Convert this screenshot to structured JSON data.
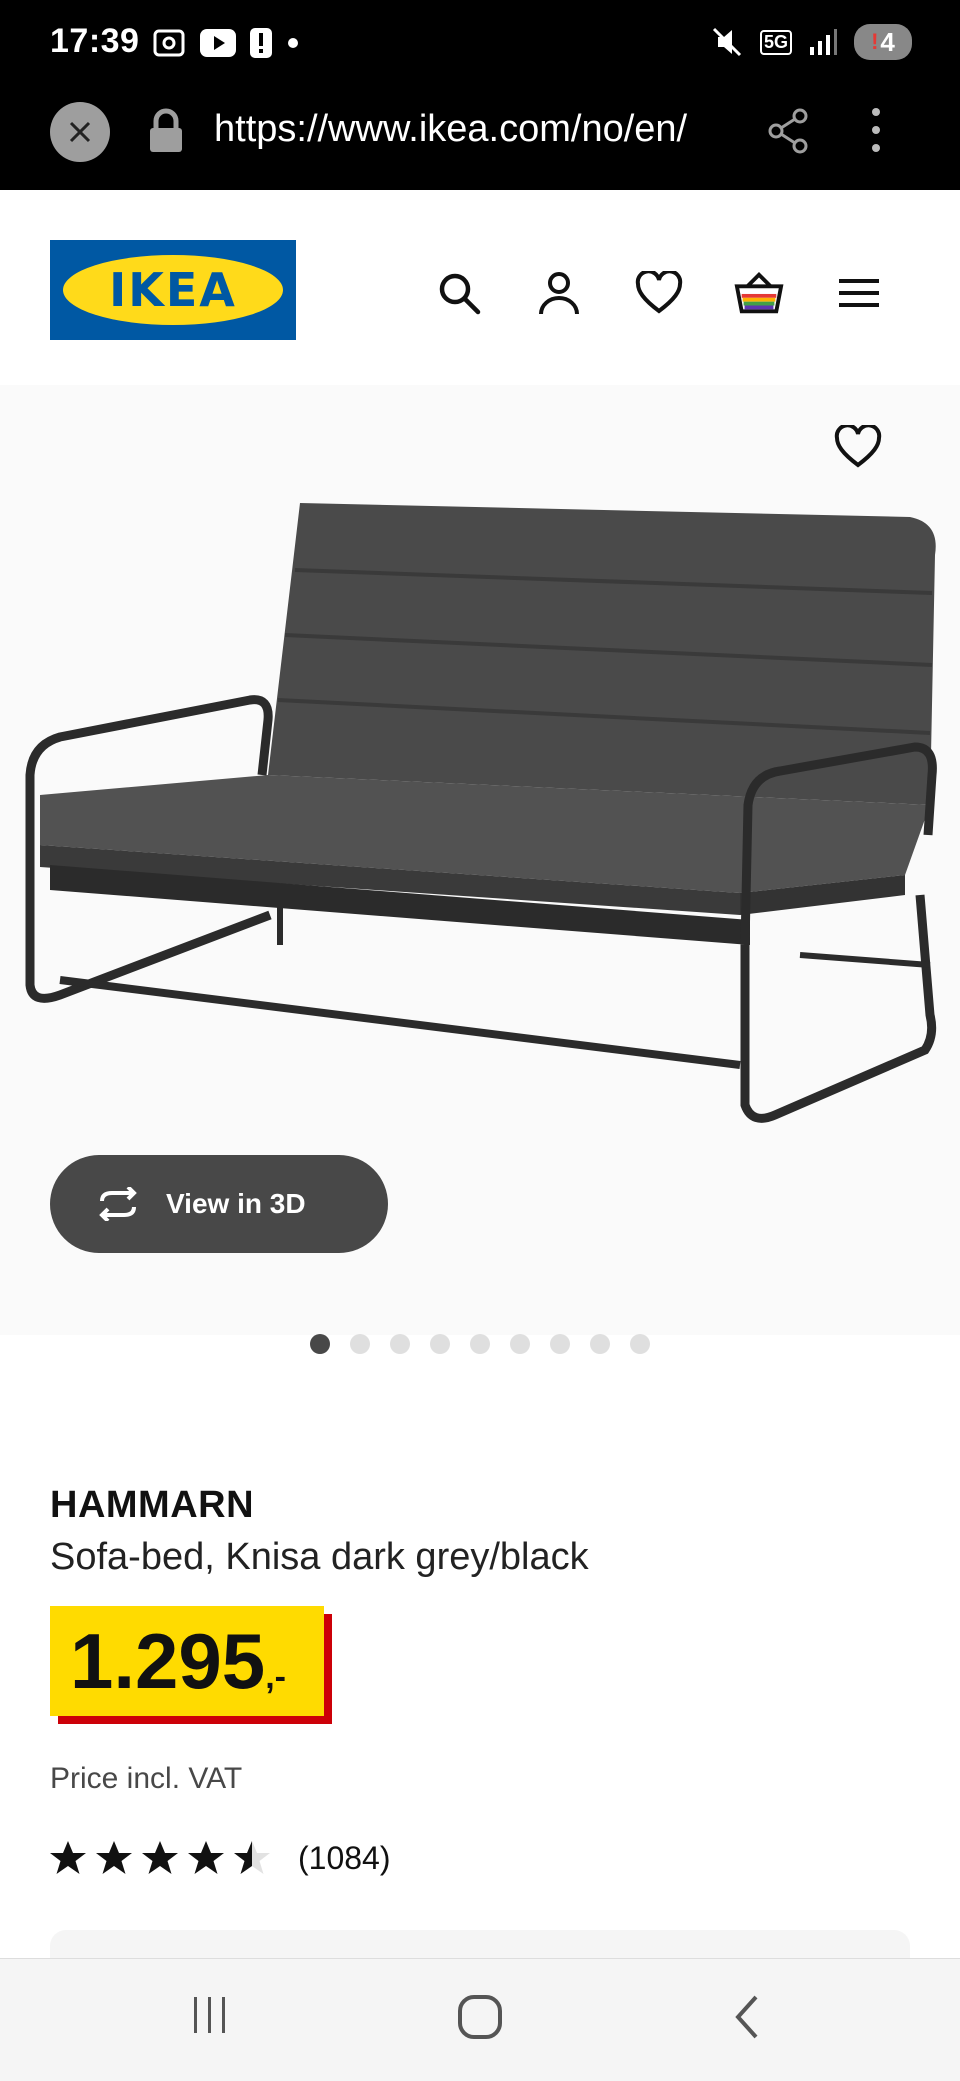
{
  "status_bar": {
    "time": "17:39",
    "network": "5G",
    "battery": "4"
  },
  "browser": {
    "url": "https://www.ikea.com/no/en/"
  },
  "header": {
    "logo_text": "IKEA"
  },
  "product": {
    "view3d_label": "View in 3D",
    "image_count": 9,
    "active_image_index": 0,
    "name": "HAMMARN",
    "description": "Sofa-bed, Knisa dark grey/black",
    "price_main": "1.295",
    "price_suffix": ",-",
    "vat_note": "Price incl. VAT",
    "rating_value": 4.5,
    "rating_max": 5,
    "rating_count": "(1084)"
  },
  "colors": {
    "ikea_blue": "#0058a3",
    "ikea_yellow": "#ffda1a",
    "price_yellow": "#ffdb00",
    "price_red": "#cc0008"
  }
}
